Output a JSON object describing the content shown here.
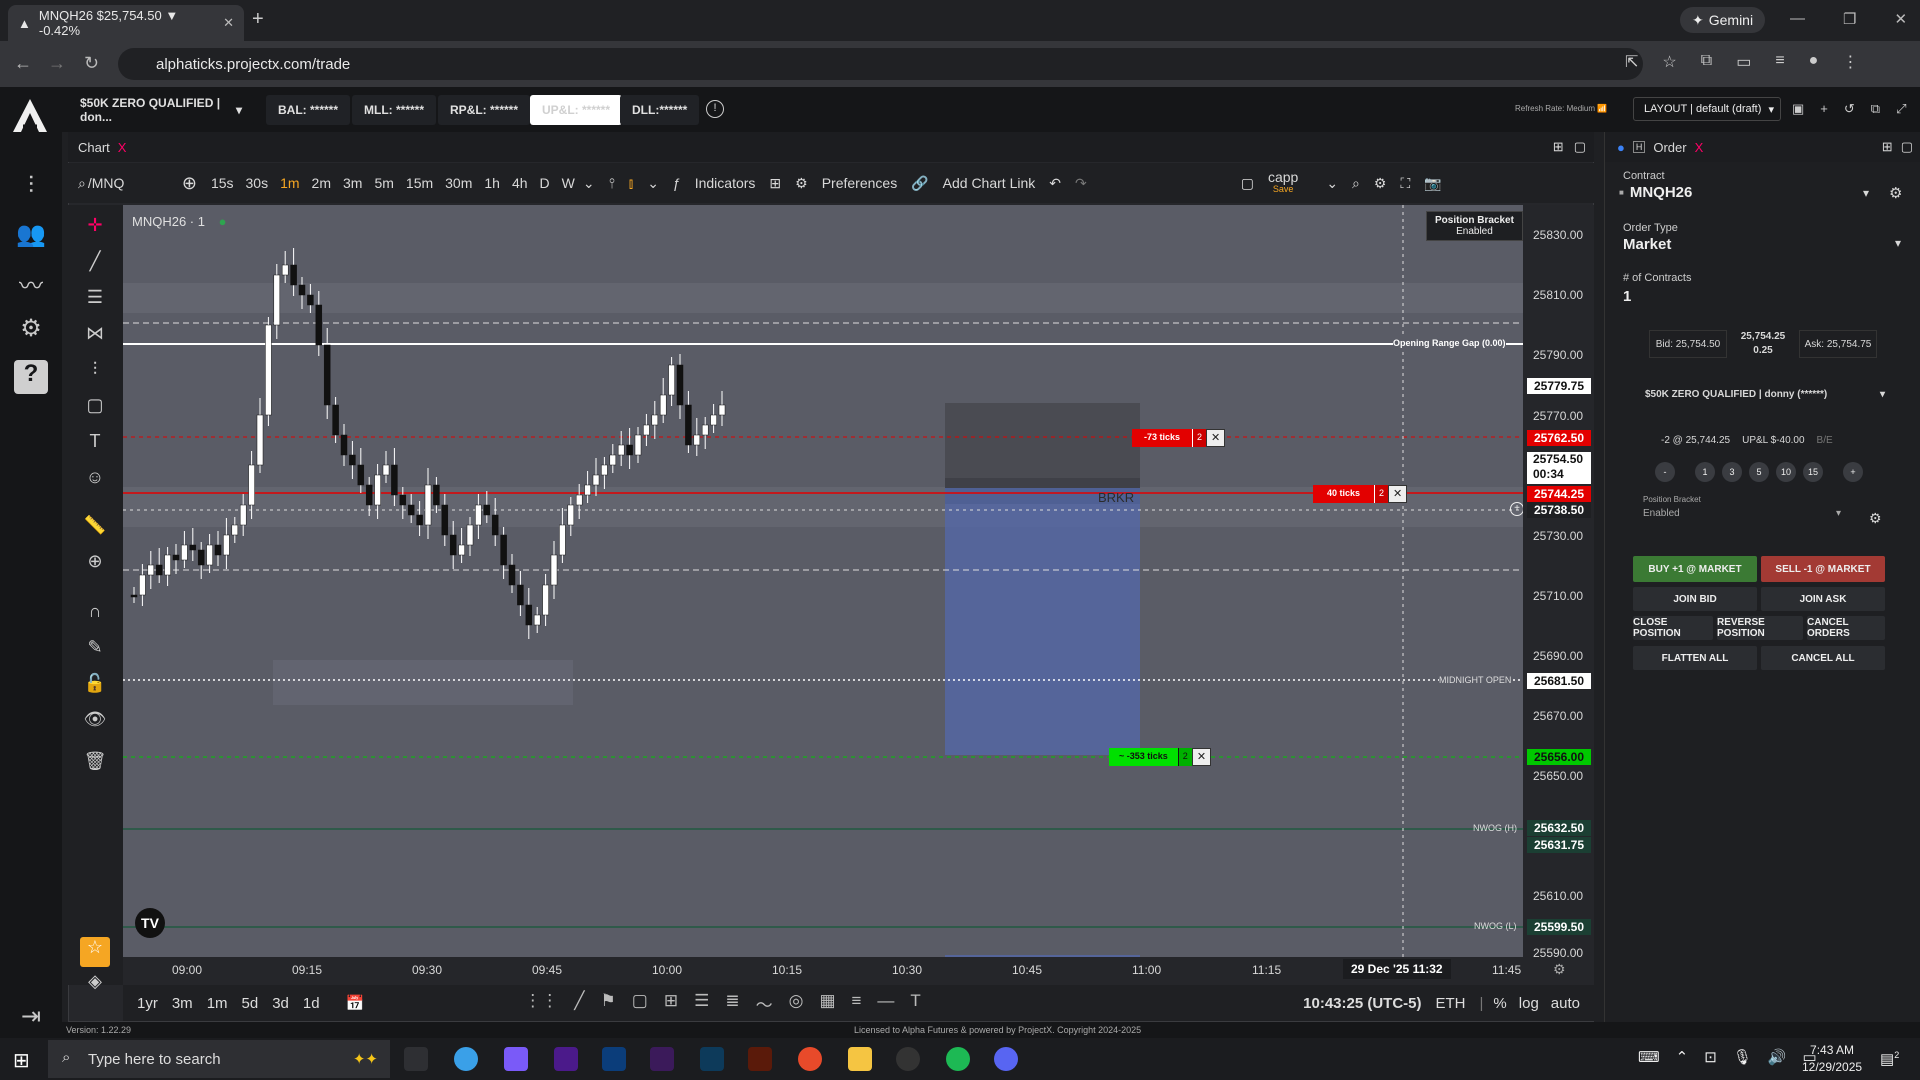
{
  "browser": {
    "tab_title": "MNQH26 $25,754.50 ▼ -0.42%",
    "gemini": "Gemini",
    "url": "alphaticks.projectx.com/trade"
  },
  "header": {
    "account": "$50K ZERO QUALIFIED | don...",
    "bal": "BAL: ******",
    "mll": "MLL: ******",
    "rpl": "RP&L: ******",
    "upl": "UP&L: ******",
    "dll": "DLL:******",
    "refresh": "Refresh Rate: Medium",
    "layout": "LAYOUT | default (draft)"
  },
  "chart": {
    "tab_label": "Chart",
    "symbol": "/MNQ",
    "intervals": [
      "15s",
      "30s",
      "1m",
      "2m",
      "3m",
      "5m",
      "15m",
      "30m",
      "1h",
      "4h",
      "D",
      "W"
    ],
    "active_interval": "1m",
    "indicators": "Indicators",
    "preferences": "Preferences",
    "add_chart_link": "Add Chart Link",
    "layout_name": "capp",
    "layout_save": "Save",
    "legend": "MNQH26 · 1",
    "position_bracket_title": "Position Bracket",
    "position_bracket_state": "Enabled",
    "opening_range": "Opening Range Gap (0.00)",
    "midnight_open": "MIDNIGHT OPEN",
    "nwog_h": "NWOG (H)",
    "nwog_l": "NWOG (L)",
    "brkr": "BRKR",
    "stop_tag": "-73 ticks",
    "stop_qty": "2",
    "limit_tag": "40 ticks",
    "limit_qty": "2",
    "position_tag": "~ -353 ticks",
    "position_qty": "2",
    "time_ticks": [
      "09:00",
      "09:15",
      "09:30",
      "09:45",
      "10:00",
      "10:15",
      "10:30",
      "10:45",
      "11:00",
      "11:15",
      "11:45"
    ],
    "crosshair_time": "29 Dec '25  11:32",
    "range_buttons": [
      "1yr",
      "3m",
      "1m",
      "5d",
      "3d",
      "1d"
    ],
    "clock": "10:43:25 (UTC-5)",
    "session": "ETH",
    "pct": "%",
    "log": "log",
    "auto": "auto"
  },
  "price_axis": {
    "ticks": [
      "25830.00",
      "25810.00",
      "25790.00",
      "25770.00",
      "25750.00",
      "25730.00",
      "25710.00",
      "25690.00",
      "25670.00",
      "25650.00",
      "25630.00",
      "25610.00",
      "25590.00"
    ],
    "opening_range_price": "25779.75",
    "stop_price": "25762.50",
    "last_price": "25754.50",
    "countdown": "00:34",
    "limit_price": "25744.25",
    "crosshair_price": "25738.50",
    "midnight_price": "25681.50",
    "position_price": "25656.00",
    "nwog_h1": "25632.50",
    "nwog_h2": "25631.75",
    "nwog_l_price": "25599.50"
  },
  "order": {
    "tab_label": "Order",
    "contract_label": "Contract",
    "contract": "MNQH26",
    "order_type_label": "Order Type",
    "order_type": "Market",
    "contracts_label": "# of Contracts",
    "contracts": "1",
    "bid": "Bid: 25,754.50",
    "mid": "25,754.25",
    "spread": "0.25",
    "ask": "Ask: 25,754.75",
    "account": "$50K ZERO QUALIFIED | donny (******)",
    "position": "-2 @ 25,744.25",
    "upl": "UP&L $-40.00",
    "be": "B/E",
    "qty_buttons": [
      "-",
      "1",
      "3",
      "5",
      "10",
      "15",
      "+"
    ],
    "bracket_label": "Position Bracket",
    "bracket_value": "Enabled",
    "buy_market": "BUY +1 @ MARKET",
    "sell_market": "SELL -1 @ MARKET",
    "join_bid": "JOIN BID",
    "join_ask": "JOIN ASK",
    "close_position": "CLOSE POSITION",
    "reverse_position": "REVERSE POSITION",
    "cancel_orders": "CANCEL ORDERS",
    "flatten_all": "FLATTEN ALL",
    "cancel_all": "CANCEL ALL"
  },
  "footer": {
    "version": "Version: 1.22.29",
    "license": "Licensed to Alpha Futures & powered by ProjectX. Copyright 2024-2025"
  },
  "taskbar": {
    "search_placeholder": "Type here to search",
    "time": "7:43 AM",
    "date": "12/29/2025",
    "notifications": "2"
  },
  "colors": {
    "accent_red": "#e30000",
    "accent_green": "#00c800",
    "buy_green": "#3b7a34",
    "sell_red": "#a33a34",
    "plot_bg": "#5a5c66"
  }
}
